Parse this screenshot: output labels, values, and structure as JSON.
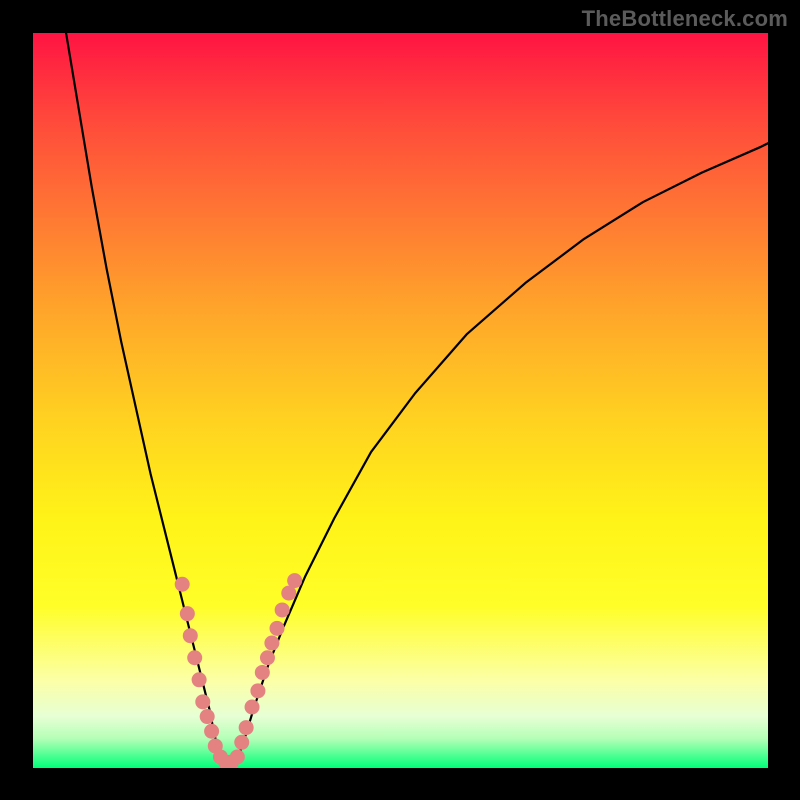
{
  "watermark": "TheBottleneck.com",
  "chart_data": {
    "type": "line",
    "title": "",
    "xlabel": "",
    "ylabel": "",
    "xlim": [
      0,
      100
    ],
    "ylim": [
      0,
      100
    ],
    "grid": false,
    "legend": false,
    "background_gradient": {
      "orientation": "vertical",
      "stops": [
        {
          "pos": 0.0,
          "color": "#ff1443"
        },
        {
          "pos": 0.04,
          "color": "#ff2640"
        },
        {
          "pos": 0.12,
          "color": "#ff4a3b"
        },
        {
          "pos": 0.22,
          "color": "#ff6e35"
        },
        {
          "pos": 0.38,
          "color": "#ffa62a"
        },
        {
          "pos": 0.52,
          "color": "#ffd021"
        },
        {
          "pos": 0.66,
          "color": "#fff318"
        },
        {
          "pos": 0.78,
          "color": "#fffe28"
        },
        {
          "pos": 0.88,
          "color": "#fcffa5"
        },
        {
          "pos": 0.93,
          "color": "#e6ffd4"
        },
        {
          "pos": 0.96,
          "color": "#b4ffb7"
        },
        {
          "pos": 1.0,
          "color": "#00ff78"
        }
      ]
    },
    "series": [
      {
        "name": "left-curve",
        "stroke": "#000000",
        "stroke_width": 2.2,
        "x": [
          4.5,
          6,
          8,
          10,
          12,
          14,
          16,
          18,
          19,
          20,
          21,
          22,
          23,
          24,
          24.7,
          25.3,
          25.8
        ],
        "y": [
          100,
          91,
          79,
          68,
          58,
          49,
          40,
          32,
          28,
          24,
          20,
          16,
          12,
          8,
          4.5,
          2,
          0.8
        ]
      },
      {
        "name": "right-curve",
        "stroke": "#000000",
        "stroke_width": 2.2,
        "x": [
          27.5,
          28.5,
          30,
          32,
          34,
          37,
          41,
          46,
          52,
          59,
          67,
          75,
          83,
          91,
          99,
          100
        ],
        "y": [
          0.8,
          3,
          8,
          14,
          19,
          26,
          34,
          43,
          51,
          59,
          66,
          72,
          77,
          81,
          84.5,
          85
        ]
      },
      {
        "name": "valley-floor",
        "stroke": "#000000",
        "stroke_width": 2.2,
        "x": [
          25.8,
          26.3,
          27.0,
          27.5
        ],
        "y": [
          0.8,
          0.4,
          0.4,
          0.8
        ]
      }
    ],
    "markers": [
      {
        "name": "cluster-markers",
        "color": "#e38280",
        "radius": 7.5,
        "points": [
          {
            "x": 20.3,
            "y": 25.0
          },
          {
            "x": 21.0,
            "y": 21.0
          },
          {
            "x": 21.4,
            "y": 18.0
          },
          {
            "x": 22.0,
            "y": 15.0
          },
          {
            "x": 22.6,
            "y": 12.0
          },
          {
            "x": 23.1,
            "y": 9.0
          },
          {
            "x": 23.7,
            "y": 7.0
          },
          {
            "x": 24.3,
            "y": 5.0
          },
          {
            "x": 24.8,
            "y": 3.0
          },
          {
            "x": 25.5,
            "y": 1.5
          },
          {
            "x": 26.2,
            "y": 0.8
          },
          {
            "x": 27.0,
            "y": 0.8
          },
          {
            "x": 27.8,
            "y": 1.5
          },
          {
            "x": 28.4,
            "y": 3.5
          },
          {
            "x": 29.0,
            "y": 5.5
          },
          {
            "x": 29.8,
            "y": 8.3
          },
          {
            "x": 30.6,
            "y": 10.5
          },
          {
            "x": 31.2,
            "y": 13.0
          },
          {
            "x": 31.9,
            "y": 15.0
          },
          {
            "x": 32.5,
            "y": 17.0
          },
          {
            "x": 33.2,
            "y": 19.0
          },
          {
            "x": 33.9,
            "y": 21.5
          },
          {
            "x": 34.8,
            "y": 23.8
          },
          {
            "x": 35.6,
            "y": 25.5
          }
        ]
      }
    ]
  }
}
